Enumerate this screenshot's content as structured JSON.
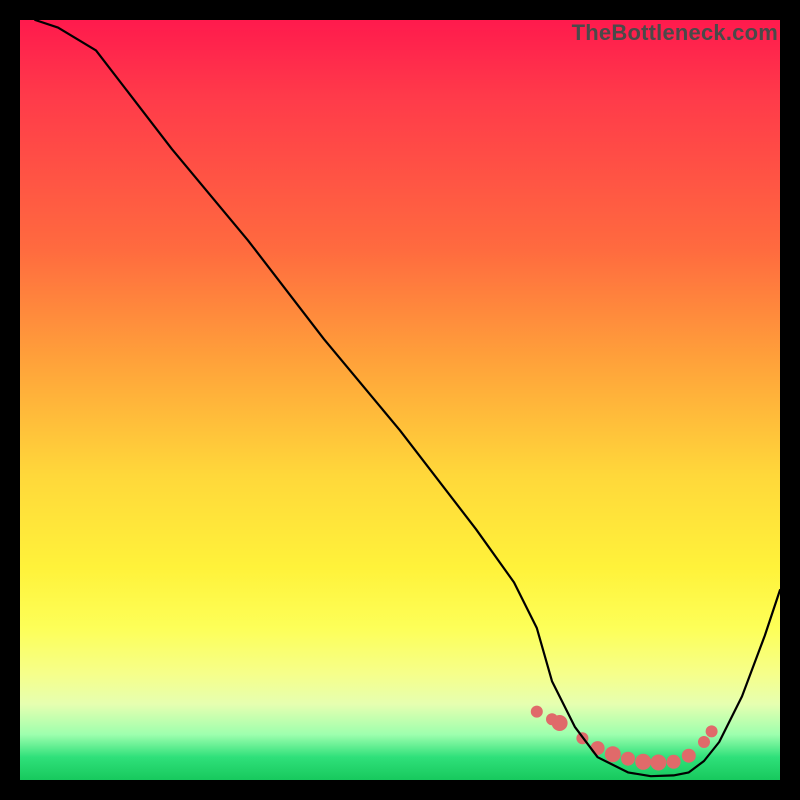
{
  "watermark": "TheBottleneck.com",
  "chart_data": {
    "type": "line",
    "title": "",
    "xlabel": "",
    "ylabel": "",
    "xlim": [
      0,
      100
    ],
    "ylim": [
      0,
      100
    ],
    "grid": false,
    "legend": false,
    "series": [
      {
        "name": "bottleneck-curve",
        "x": [
          2,
          5,
          10,
          20,
          30,
          40,
          50,
          60,
          65,
          68,
          70,
          73,
          76,
          80,
          83,
          86,
          88,
          90,
          92,
          95,
          98,
          100
        ],
        "y": [
          100,
          99,
          96,
          83,
          71,
          58,
          46,
          33,
          26,
          20,
          13,
          7,
          3,
          1,
          0.5,
          0.6,
          1,
          2.5,
          5,
          11,
          19,
          25
        ],
        "stroke": "#000000",
        "stroke_width": 2.2
      }
    ],
    "markers": {
      "name": "optimal-band-dots",
      "color": "#e06a6a",
      "points": [
        {
          "x": 68,
          "y": 9,
          "r": 6
        },
        {
          "x": 70,
          "y": 8,
          "r": 6
        },
        {
          "x": 71,
          "y": 7.5,
          "r": 8
        },
        {
          "x": 74,
          "y": 5.5,
          "r": 6
        },
        {
          "x": 76,
          "y": 4.2,
          "r": 7
        },
        {
          "x": 78,
          "y": 3.4,
          "r": 8
        },
        {
          "x": 80,
          "y": 2.8,
          "r": 7
        },
        {
          "x": 82,
          "y": 2.4,
          "r": 8
        },
        {
          "x": 84,
          "y": 2.3,
          "r": 8
        },
        {
          "x": 86,
          "y": 2.4,
          "r": 7
        },
        {
          "x": 88,
          "y": 3.2,
          "r": 7
        },
        {
          "x": 90,
          "y": 5.0,
          "r": 6
        },
        {
          "x": 91,
          "y": 6.4,
          "r": 6
        }
      ]
    }
  }
}
